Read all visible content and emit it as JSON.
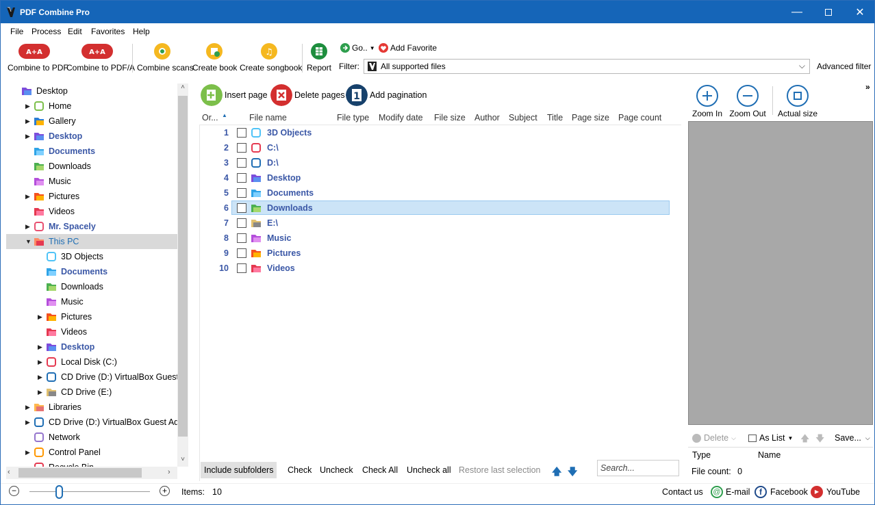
{
  "app": {
    "title": "PDF Combine Pro"
  },
  "menu": [
    "File",
    "Process",
    "Edit",
    "Favorites",
    "Help"
  ],
  "toolbar": {
    "combine_pdf": "Combine to PDF",
    "combine_pdfa": "Combine to PDF/A",
    "combine_scans": "Combine scans",
    "create_book": "Create book",
    "create_songbook": "Create songbook",
    "report": "Report",
    "go": "Go..",
    "add_favorite": "Add Favorite",
    "filter_label": "Filter:",
    "filter_value": "All supported files",
    "advanced_filter": "Advanced filter"
  },
  "tree": [
    {
      "label": "Desktop",
      "icon": "desktop-folder-icon",
      "level": 0,
      "exp": "",
      "bold": false
    },
    {
      "label": "Home",
      "icon": "home-star-icon",
      "level": 1,
      "exp": "▶",
      "bold": false
    },
    {
      "label": "Gallery",
      "icon": "gallery-icon",
      "level": 1,
      "exp": "▶",
      "bold": false
    },
    {
      "label": "Desktop",
      "icon": "desktop-folder-icon",
      "level": 1,
      "exp": "▶",
      "bold": true
    },
    {
      "label": "Documents",
      "icon": "documents-folder-icon",
      "level": 1,
      "exp": "",
      "bold": true
    },
    {
      "label": "Downloads",
      "icon": "downloads-folder-icon",
      "level": 1,
      "exp": "",
      "bold": false
    },
    {
      "label": "Music",
      "icon": "music-folder-icon",
      "level": 1,
      "exp": "",
      "bold": false
    },
    {
      "label": "Pictures",
      "icon": "pictures-folder-icon",
      "level": 1,
      "exp": "▶",
      "bold": false
    },
    {
      "label": "Videos",
      "icon": "videos-folder-icon",
      "level": 1,
      "exp": "",
      "bold": false
    },
    {
      "label": "Mr. Spacely",
      "icon": "user-icon",
      "level": 1,
      "exp": "▶",
      "bold": true
    },
    {
      "label": "This PC",
      "icon": "computer-icon",
      "level": 1,
      "exp": "▼",
      "bold": false,
      "selected": true
    },
    {
      "label": "3D Objects",
      "icon": "3d-objects-icon",
      "level": 2,
      "exp": "",
      "bold": false
    },
    {
      "label": "Documents",
      "icon": "documents-folder-icon",
      "level": 2,
      "exp": "",
      "bold": true
    },
    {
      "label": "Downloads",
      "icon": "downloads-folder-icon",
      "level": 2,
      "exp": "",
      "bold": false
    },
    {
      "label": "Music",
      "icon": "music-folder-icon",
      "level": 2,
      "exp": "",
      "bold": false
    },
    {
      "label": "Pictures",
      "icon": "pictures-folder-icon",
      "level": 2,
      "exp": "▶",
      "bold": false
    },
    {
      "label": "Videos",
      "icon": "videos-folder-icon",
      "level": 2,
      "exp": "",
      "bold": false
    },
    {
      "label": "Desktop",
      "icon": "desktop-folder-icon",
      "level": 2,
      "exp": "▶",
      "bold": true
    },
    {
      "label": "Local Disk (C:)",
      "icon": "local-disk-icon",
      "level": 2,
      "exp": "▶",
      "bold": false
    },
    {
      "label": "CD Drive (D:) VirtualBox Guest Ad",
      "icon": "cd-drive-vbox-icon",
      "level": 2,
      "exp": "▶",
      "bold": false
    },
    {
      "label": "CD Drive (E:)",
      "icon": "cd-drive-icon",
      "level": 2,
      "exp": "▶",
      "bold": false
    },
    {
      "label": "Libraries",
      "icon": "libraries-icon",
      "level": 1,
      "exp": "▶",
      "bold": false
    },
    {
      "label": "CD Drive (D:) VirtualBox Guest Additi",
      "icon": "cd-drive-vbox-icon",
      "level": 1,
      "exp": "▶",
      "bold": false
    },
    {
      "label": "Network",
      "icon": "network-icon",
      "level": 1,
      "exp": "",
      "bold": false
    },
    {
      "label": "Control Panel",
      "icon": "control-panel-icon",
      "level": 1,
      "exp": "▶",
      "bold": false
    },
    {
      "label": "Recycle Bin",
      "icon": "recycle-bin-icon",
      "level": 1,
      "exp": "",
      "bold": false
    }
  ],
  "center": {
    "insert_page": "Insert page",
    "delete_pages": "Delete pages",
    "add_pagination": "Add pagination",
    "columns": [
      "Or...",
      "File name",
      "File type",
      "Modify date",
      "File size",
      "Author",
      "Subject",
      "Title",
      "Page size",
      "Page count"
    ],
    "rows": [
      {
        "num": "1",
        "name": "3D Objects",
        "icon": "3d-objects-icon"
      },
      {
        "num": "2",
        "name": "C:\\",
        "icon": "local-disk-icon"
      },
      {
        "num": "3",
        "name": "D:\\",
        "icon": "cd-drive-vbox-icon"
      },
      {
        "num": "4",
        "name": "Desktop",
        "icon": "desktop-folder-icon"
      },
      {
        "num": "5",
        "name": "Documents",
        "icon": "documents-folder-icon"
      },
      {
        "num": "6",
        "name": "Downloads",
        "icon": "downloads-folder-icon",
        "selected": true
      },
      {
        "num": "7",
        "name": "E:\\",
        "icon": "cd-drive-icon"
      },
      {
        "num": "8",
        "name": "Music",
        "icon": "music-folder-icon"
      },
      {
        "num": "9",
        "name": "Pictures",
        "icon": "pictures-folder-icon"
      },
      {
        "num": "10",
        "name": "Videos",
        "icon": "videos-folder-icon"
      }
    ],
    "include_subfolders": "Include subfolders",
    "check": "Check",
    "uncheck": "Uncheck",
    "check_all": "Check All",
    "uncheck_all": "Uncheck all",
    "restore": "Restore last selection",
    "search_placeholder": "Search..."
  },
  "right": {
    "zoom_in": "Zoom In",
    "zoom_out": "Zoom Out",
    "actual_size": "Actual size",
    "delete": "Delete",
    "as_list": "As List",
    "save": "Save...",
    "col_type": "Type",
    "col_name": "Name",
    "file_count_label": "File count:",
    "file_count": "0"
  },
  "status": {
    "items_label": "Items:",
    "items": "10",
    "contact": "Contact us",
    "email": "E-mail",
    "facebook": "Facebook",
    "youtube": "YouTube"
  },
  "colors": {
    "titlebar": "#1565b8",
    "accent": "#3a57a6",
    "selection": "#cce4f7"
  }
}
